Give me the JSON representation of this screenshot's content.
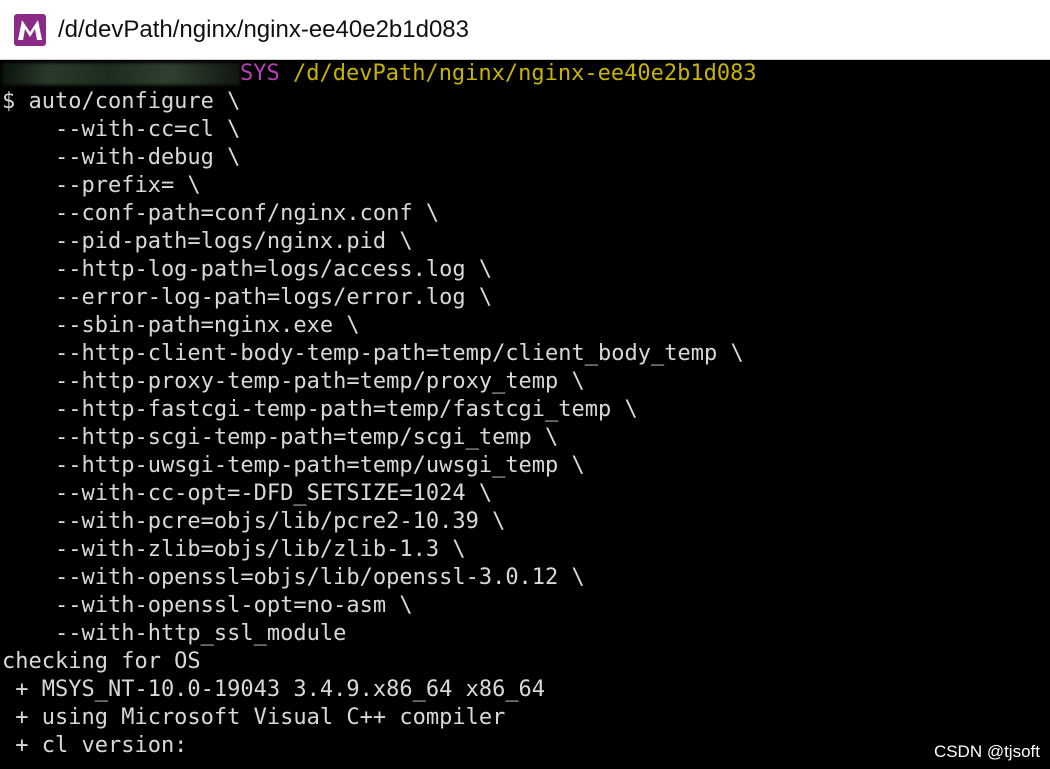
{
  "window": {
    "title": "/d/devPath/nginx/nginx-ee40e2b1d083",
    "icon": "mintty-icon",
    "icon_letter": "M"
  },
  "prompt": {
    "system": "SYS",
    "path": " /d/devPath/nginx/nginx-ee40e2b1d083"
  },
  "lines": [
    "$ auto/configure \\",
    "    --with-cc=cl \\",
    "    --with-debug \\",
    "    --prefix= \\",
    "    --conf-path=conf/nginx.conf \\",
    "    --pid-path=logs/nginx.pid \\",
    "    --http-log-path=logs/access.log \\",
    "    --error-log-path=logs/error.log \\",
    "    --sbin-path=nginx.exe \\",
    "    --http-client-body-temp-path=temp/client_body_temp \\",
    "    --http-proxy-temp-path=temp/proxy_temp \\",
    "    --http-fastcgi-temp-path=temp/fastcgi_temp \\",
    "    --http-scgi-temp-path=temp/scgi_temp \\",
    "    --http-uwsgi-temp-path=temp/uwsgi_temp \\",
    "    --with-cc-opt=-DFD_SETSIZE=1024 \\",
    "    --with-pcre=objs/lib/pcre2-10.39 \\",
    "    --with-zlib=objs/lib/zlib-1.3 \\",
    "    --with-openssl=objs/lib/openssl-3.0.12 \\",
    "    --with-openssl-opt=no-asm \\",
    "    --with-http_ssl_module",
    "checking for OS",
    " + MSYS_NT-10.0-19043 3.4.9.x86_64 x86_64",
    " + using Microsoft Visual C++ compiler",
    " + cl version:"
  ],
  "watermark": "CSDN @tjsoft",
  "colors": {
    "background": "#000000",
    "text": "#d8d8d8",
    "prompt_system": "#b840b8",
    "prompt_path": "#c8b400",
    "titlebar": "#ffffff",
    "icon": "#8b2a86"
  }
}
